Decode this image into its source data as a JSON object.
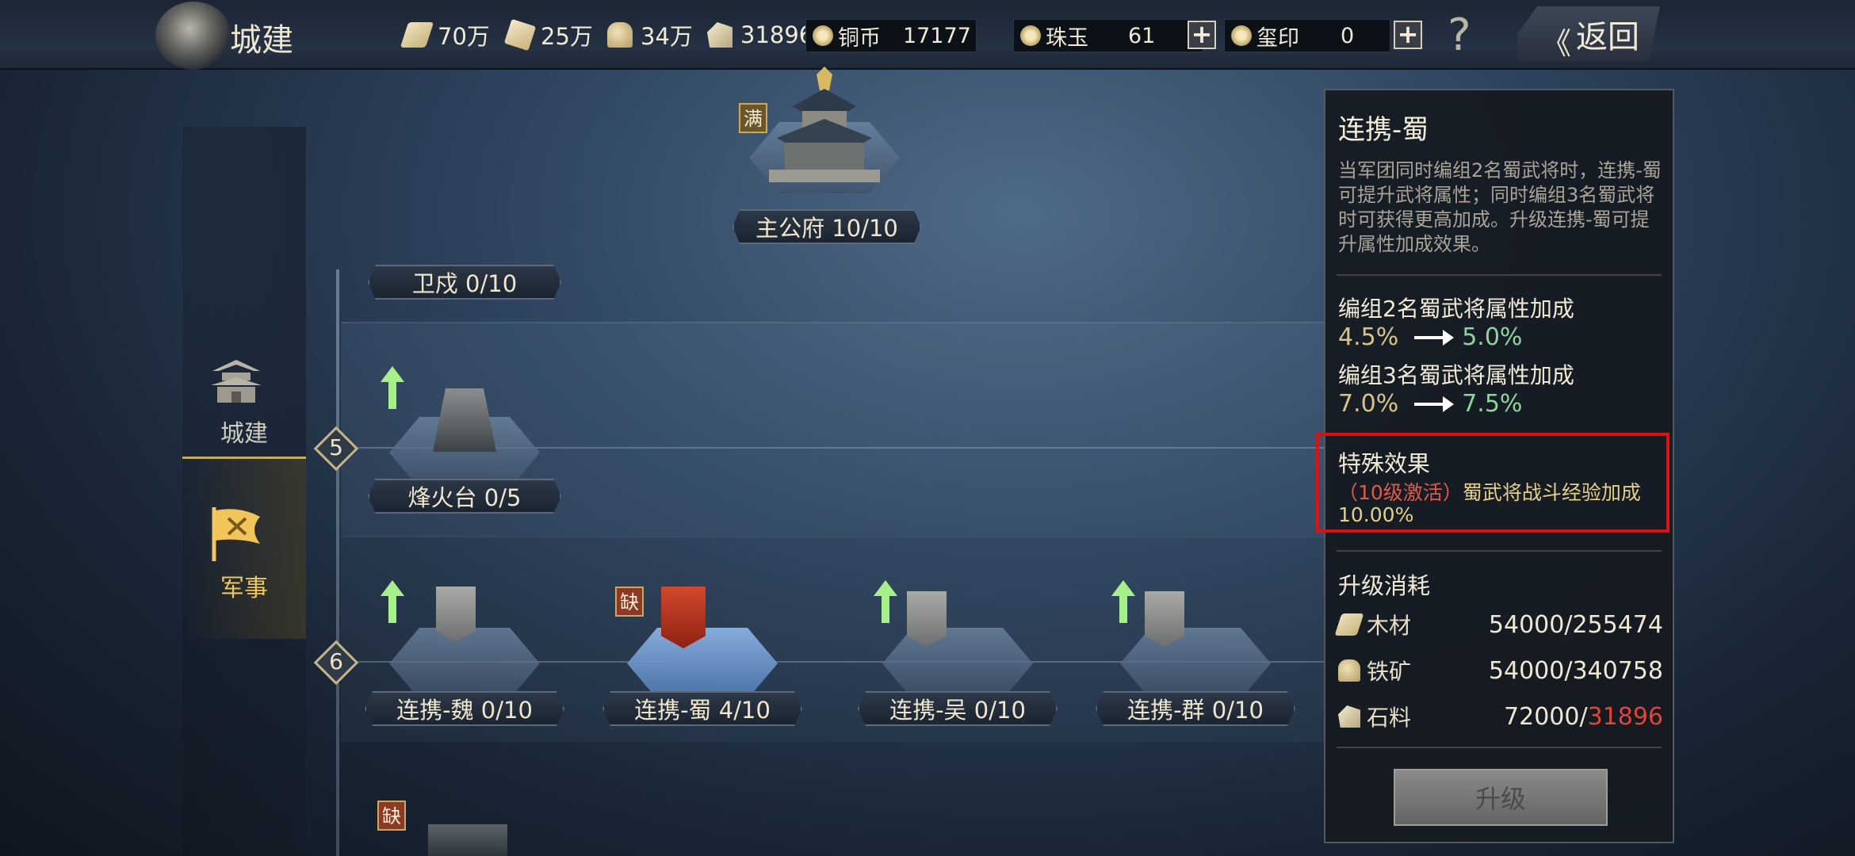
{
  "header": {
    "title": "城建",
    "resources": [
      {
        "icon": "wood-icon",
        "value": "70万"
      },
      {
        "icon": "scroll-icon",
        "value": "25万"
      },
      {
        "icon": "ore-icon",
        "value": "34万"
      },
      {
        "icon": "stone-icon",
        "value": "31896"
      }
    ],
    "copper": {
      "label": "铜币",
      "value": "17177"
    },
    "jade": {
      "label": "珠玉",
      "value": "61"
    },
    "seal": {
      "label": "玺印",
      "value": "0"
    },
    "plus": "+",
    "help": "?",
    "back_label": "返回"
  },
  "sidebar": {
    "tabs": [
      {
        "label": "城建",
        "active": false
      },
      {
        "label": "军事",
        "active": true
      }
    ]
  },
  "map": {
    "buildings": {
      "main_hall": {
        "label": "主公府 10/10",
        "badge": "满"
      },
      "guard": {
        "label": "卫戍 0/10"
      },
      "beacon": {
        "label": "烽火台 0/5"
      },
      "link_wei": {
        "label": "连携-魏 0/10"
      },
      "link_shu": {
        "label": "连携-蜀 4/10",
        "badge": "缺"
      },
      "link_wu": {
        "label": "连携-吴 0/10"
      },
      "link_qun": {
        "label": "连携-群 0/10"
      },
      "bottom": {
        "badge": "缺"
      }
    },
    "levels": [
      "5",
      "6"
    ]
  },
  "panel": {
    "title": "连携-蜀",
    "description": "当军团同时编组2名蜀武将时，连携-蜀可提升武将属性；同时编组3名蜀武将时可获得更高加成。升级连携-蜀可提升属性加成效果。",
    "attr1": {
      "label": "编组2名蜀武将属性加成",
      "current": "4.5%",
      "next": "5.0%"
    },
    "attr2": {
      "label": "编组3名蜀武将属性加成",
      "current": "7.0%",
      "next": "7.5%"
    },
    "special": {
      "title": "特殊效果",
      "activation": "（10级激活）",
      "effect": "蜀武将战斗经验加成10.00%"
    },
    "cost": {
      "title": "升级消耗",
      "wood": {
        "name": "木材",
        "value": "54000/255474"
      },
      "iron": {
        "name": "铁矿",
        "value": "54000/340758"
      },
      "stone": {
        "name": "石料",
        "need": "72000/",
        "have": "31896"
      }
    },
    "upgrade_label": "升级"
  },
  "colors": {
    "attr_current": "#d8c489",
    "attr_next": "#8fd49b",
    "insufficient": "#e0443a",
    "highlight_box": "#e01010",
    "active_tab": "#f2c55a"
  }
}
